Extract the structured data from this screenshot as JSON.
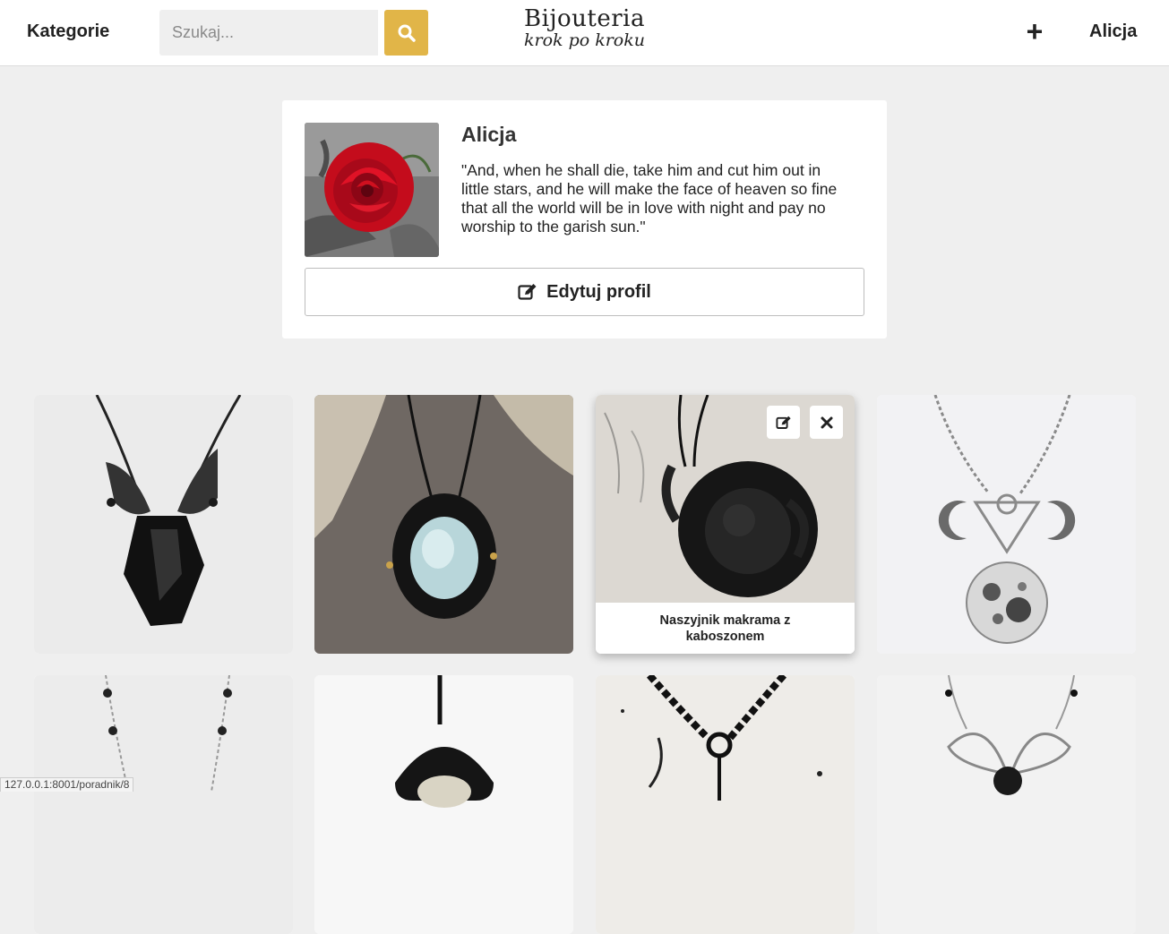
{
  "header": {
    "categories_label": "Kategorie",
    "search_placeholder": "Szukaj...",
    "logo_line1": "Bijouteria",
    "logo_line2": "krok po kroku",
    "add_label": "+",
    "user_label": "Alicja"
  },
  "profile": {
    "name": "Alicja",
    "quote": "\"And, when he shall die, take him and cut him out in little stars, and he will make the face of heaven so fine that all the world will be in love with night and pay no worship to the garish sun.\"",
    "edit_label": "Edytuj profil"
  },
  "grid": {
    "hovered_caption": "Naszyjnik makrama z kaboszonem"
  },
  "status_bar": {
    "url": "127.0.0.1:8001/poradnik/8"
  },
  "colors": {
    "accent": "#e1b548",
    "page_bg": "#efefef"
  }
}
